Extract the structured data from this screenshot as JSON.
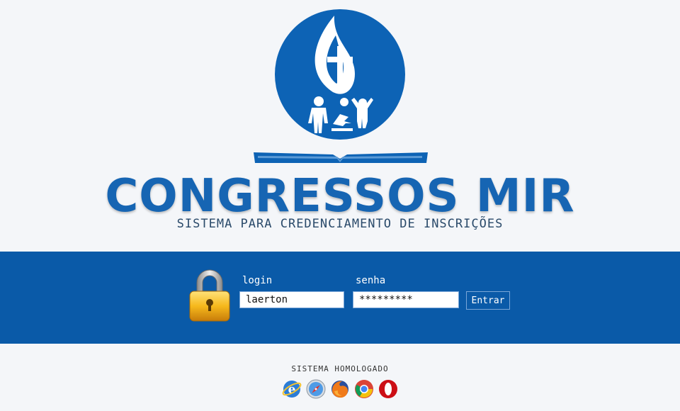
{
  "brand": {
    "title": "CONGRESSOS MIR",
    "subtitle": "SISTEMA PARA CREDENCIAMENTO DE INSCRIÇÕES",
    "color": "#1665b3"
  },
  "login_form": {
    "login_label": "login",
    "login_value": "laerton",
    "password_label": "senha",
    "password_value": "*********",
    "submit_label": "Entrar",
    "band_color": "#0a5aa8"
  },
  "footer": {
    "homologated_text": "SISTEMA HOMOLOGADO",
    "browsers": [
      {
        "icon": "internet-explorer-icon"
      },
      {
        "icon": "safari-icon"
      },
      {
        "icon": "firefox-icon"
      },
      {
        "icon": "chrome-icon"
      },
      {
        "icon": "opera-icon"
      }
    ]
  }
}
